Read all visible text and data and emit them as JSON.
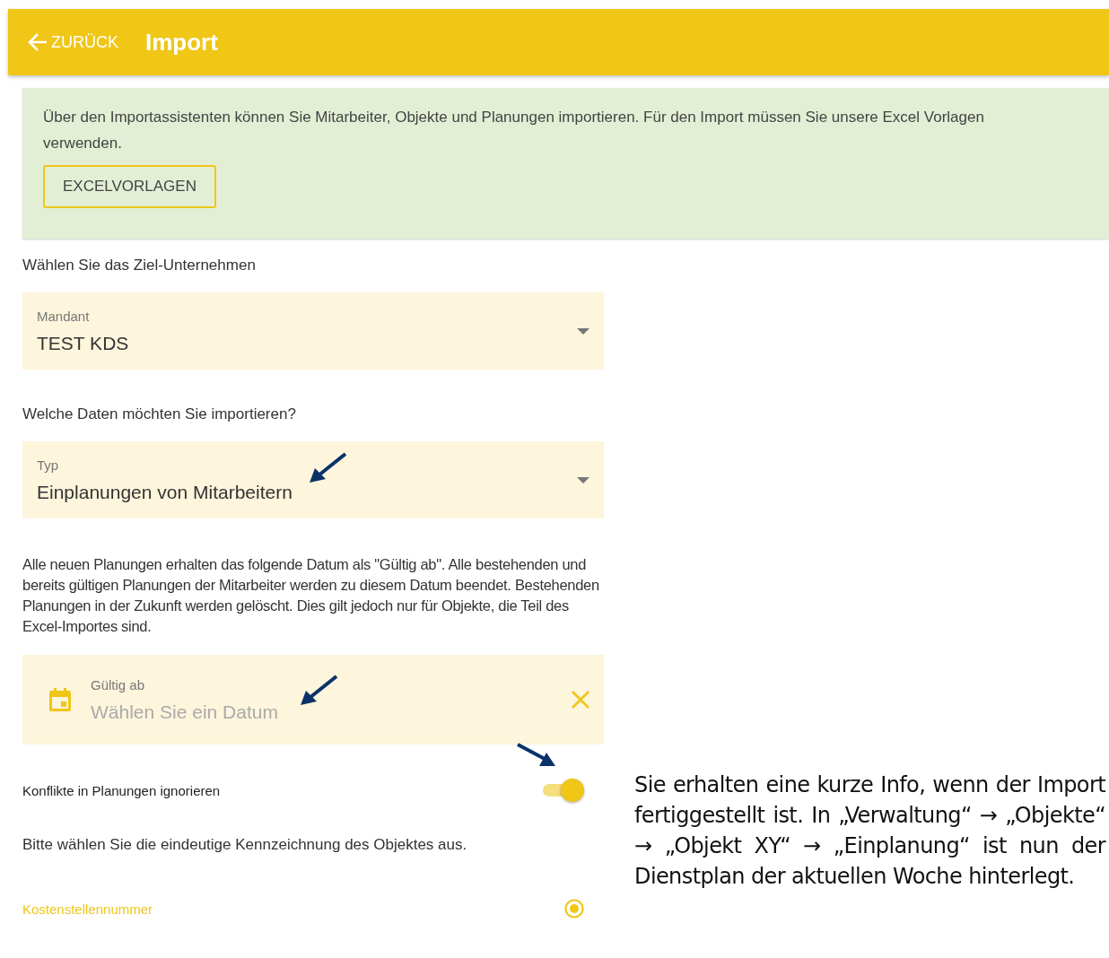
{
  "header": {
    "back_label": "ZURÜCK",
    "title": "Import"
  },
  "info": {
    "text": "Über den Importassistenten können Sie Mitarbeiter, Objekte und Planungen importieren. Für den Import müssen Sie unsere Excel Vorlagen verwenden.",
    "button": "EXCELVORLAGEN"
  },
  "form": [
    {
      "kind": "label",
      "text": "Wählen Sie das Ziel-Unternehmen"
    },
    {
      "kind": "select",
      "label": "Mandant",
      "value": "TEST KDS",
      "annotated": false
    },
    {
      "kind": "label",
      "text": "Welche Daten möchten Sie importieren?"
    },
    {
      "kind": "select",
      "label": "Typ",
      "value": "Einplanungen von Mitarbeitern",
      "annotated": true
    },
    {
      "kind": "paragraph",
      "text": "Alle neuen Planungen erhalten das folgende Datum als \"Gültig ab\". Alle bestehenden und bereits gültigen Planungen der Mitarbeiter werden zu diesem Datum beendet. Bestehenden Planungen in der Zukunft werden gelöscht. Dies gilt jedoch nur für Objekte, die Teil des Excel-Importes sind."
    },
    {
      "kind": "date",
      "label": "Gültig ab",
      "placeholder": "Wählen Sie ein Datum",
      "annotated": true
    },
    {
      "kind": "toggle",
      "label": "Konflikte in Planungen ignorieren",
      "on": true,
      "annotated": true
    },
    {
      "kind": "label",
      "text": "Bitte wählen Sie die eindeutige Kennzeichnung des Objektes aus."
    },
    {
      "kind": "radio",
      "label": "Kostenstellennummer",
      "selected": true
    }
  ],
  "note": "Sie erhalten eine kurze Info, wenn der Import fertiggestellt ist. In „Verwaltung“ → „Objekte“ → „Objekt XY“ → „Einplanung“ ist nun der Dienstplan der aktuellen Woche hinterlegt."
}
